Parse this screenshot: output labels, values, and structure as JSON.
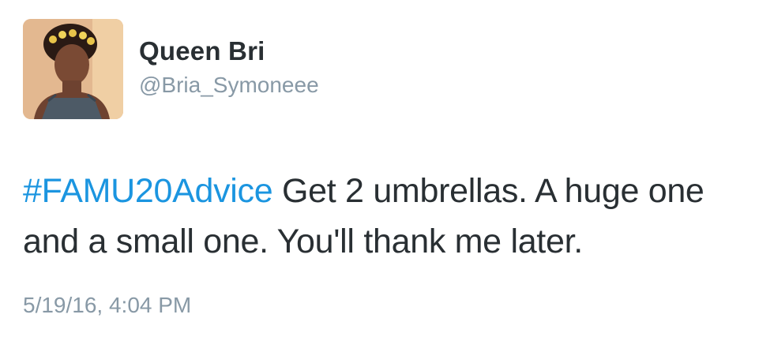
{
  "user": {
    "display_name": "Queen Bri",
    "handle": "@Bria_Symoneee"
  },
  "tweet": {
    "hashtag": "#FAMU20Advice",
    "body": " Get 2 umbrellas. A huge one and a small one. You'll thank me later.",
    "timestamp": "5/19/16, 4:04 PM"
  },
  "colors": {
    "text": "#292f33",
    "secondary": "#8899a6",
    "link": "#1b95e0"
  }
}
